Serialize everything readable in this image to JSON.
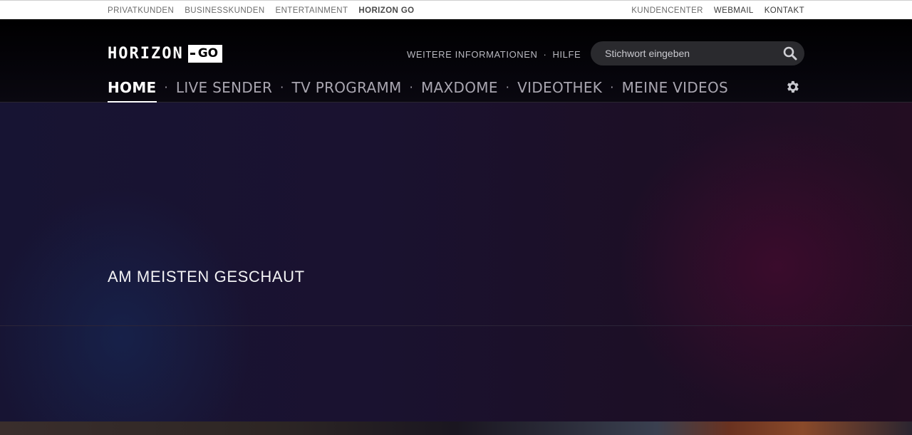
{
  "topbar": {
    "left_links": [
      "PRIVATKUNDEN",
      "BUSINESSKUNDEN",
      "ENTERTAINMENT",
      "HORIZON GO"
    ],
    "right_links": [
      "KUNDENCENTER",
      "WEBMAIL",
      "KONTAKT"
    ]
  },
  "header": {
    "logo_word": "HORIZON",
    "logo_go": "GO",
    "info_links": [
      "WEITERE INFORMATIONEN",
      "HILFE"
    ],
    "search": {
      "placeholder": "Stichwort eingeben"
    }
  },
  "nav": {
    "items": [
      "HOME",
      "LIVE SENDER",
      "TV PROGRAMM",
      "MAXDOME",
      "VIDEOTHEK",
      "MEINE VIDEOS"
    ],
    "active": "HOME"
  },
  "content": {
    "section_title": "AM MEISTEN GESCHAUT"
  },
  "icons": {
    "search": "search-icon",
    "settings": "gear-icon"
  },
  "colors": {
    "accent": "#ffffff",
    "nav_inactive": "#a9a6b0",
    "search_bg": "#2a2a2e"
  }
}
